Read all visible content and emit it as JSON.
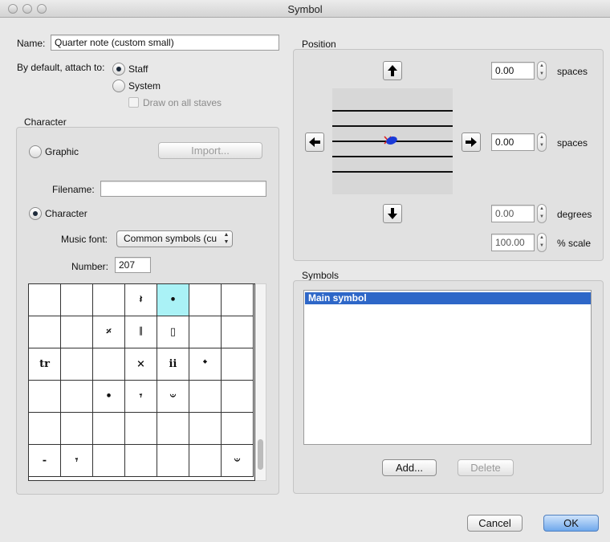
{
  "window": {
    "title": "Symbol"
  },
  "name_field": {
    "label": "Name:",
    "value": "Quarter note (custom small)"
  },
  "attach": {
    "label": "By default, attach to:",
    "staff_label": "Staff",
    "system_label": "System",
    "selected": "staff",
    "draw_on_all_staves_label": "Draw on all staves"
  },
  "character_group": {
    "title": "Character",
    "graphic_label": "Graphic",
    "import_label": "Import...",
    "filename_label": "Filename:",
    "filename_value": "",
    "character_label": "Character",
    "selected": "character",
    "music_font_label": "Music font:",
    "music_font_value": "Common symbols (cu",
    "number_label": "Number:",
    "number_value": "207",
    "selected_cell": {
      "row": 0,
      "col": 4
    },
    "grid": [
      [
        "",
        "",
        "",
        "𝄽",
        "•",
        "",
        ""
      ],
      [
        "",
        "",
        "𝄎",
        "𝄁",
        "▯",
        "",
        ""
      ],
      [
        "tr",
        "",
        "",
        "×",
        "ⅱ",
        "𝄌",
        ""
      ],
      [
        "",
        "",
        "•",
        "𝄾",
        "𝄑",
        "",
        ""
      ],
      [
        "",
        "",
        "",
        "",
        "",
        "",
        ""
      ],
      [
        "-",
        "𝄾",
        "",
        "",
        "",
        "",
        "𝄑"
      ]
    ]
  },
  "position_group": {
    "title": "Position",
    "y_offset": {
      "value": "0.00",
      "unit": "spaces"
    },
    "x_offset": {
      "value": "0.00",
      "unit": "spaces"
    },
    "rotation": {
      "value": "0.00",
      "unit": "degrees"
    },
    "scale": {
      "value": "100.00",
      "unit": "% scale"
    }
  },
  "symbols_group": {
    "title": "Symbols",
    "items": [
      "Main symbol"
    ],
    "add_label": "Add...",
    "delete_label": "Delete"
  },
  "footer": {
    "cancel_label": "Cancel",
    "ok_label": "OK"
  },
  "icons": {
    "up_arrow": "up-arrow-icon",
    "down_arrow": "down-arrow-icon",
    "left_arrow": "left-arrow-icon",
    "right_arrow": "right-arrow-icon"
  },
  "colors": {
    "selection": "#2e67c8",
    "selected_cell": "#aaf2f6",
    "ok_button": "#6fa8ec",
    "symbol_blue": "#1a3ad8",
    "origin_red": "#e02020"
  }
}
